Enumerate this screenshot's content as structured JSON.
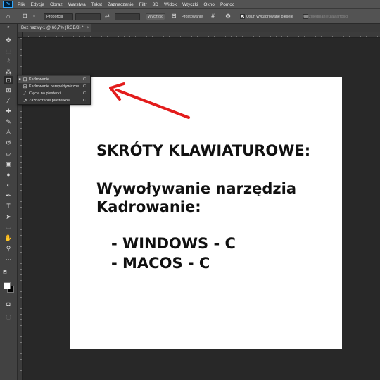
{
  "app": {
    "logo_text": "Ps"
  },
  "menu": [
    "Plik",
    "Edycja",
    "Obraz",
    "Warstwa",
    "Tekst",
    "Zaznaczanie",
    "Filtr",
    "3D",
    "Widok",
    "Wtyczki",
    "Okno",
    "Pomoc"
  ],
  "options": {
    "home_icon": "home-icon",
    "crop_icon": "crop-icon",
    "ratio_label": "Proporcja",
    "width_value": "",
    "height_value": "",
    "swap_icon": "swap-icon",
    "clear_label": "Wyczyść",
    "straighten_label": "Prostowanie",
    "grid_icon": "grid-overlay-icon",
    "settings_icon": "gear-icon",
    "delete_cropped_checked": true,
    "delete_cropped_label": "Usuń wykadrowane piksele",
    "content_aware_checked": false,
    "content_aware_label": "Uwzględnianie zawartości"
  },
  "tab": {
    "title": "Bez nazwy-1 @ 66,7% (RGB/8) *",
    "close": "×"
  },
  "flyout": {
    "items": [
      {
        "label": "Kadrowanie",
        "key": "C",
        "icon": "crop-icon",
        "selected": true
      },
      {
        "label": "Kadrowanie perspektywiczne",
        "key": "C",
        "icon": "perspective-crop-icon",
        "selected": false
      },
      {
        "label": "Cięcie na plasterki",
        "key": "C",
        "icon": "slice-icon",
        "selected": false
      },
      {
        "label": "Zaznaczanie plasterków",
        "key": "C",
        "icon": "slice-select-icon",
        "selected": false
      }
    ]
  },
  "canvas": {
    "heading": "SKRÓTY KLAWIATUROWE:",
    "line1": "Wywoływanie narzędzia",
    "line2": "Kadrowanie:",
    "win": "- WINDOWS - C",
    "mac": "- MACOS - C"
  },
  "colors": {
    "arrow": "#e31c1c",
    "foreground": "#ffffff",
    "background": "#000000"
  }
}
